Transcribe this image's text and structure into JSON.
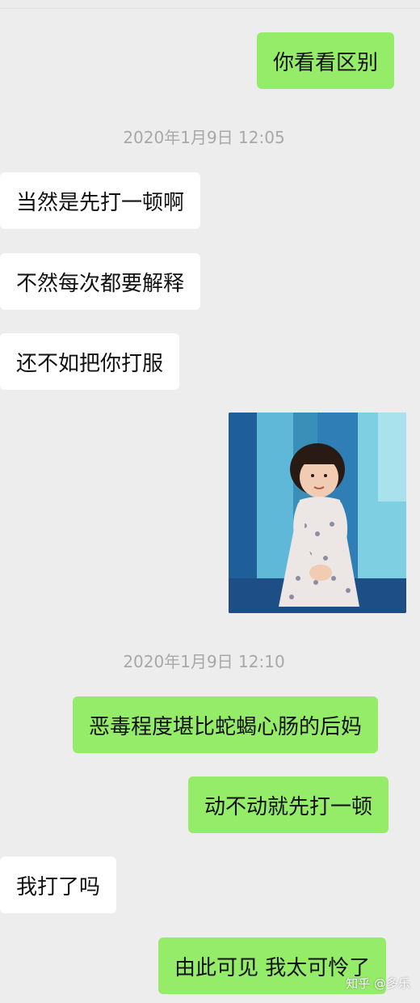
{
  "colors": {
    "background": "#ededed",
    "sent_bubble": "#95ec69",
    "received_bubble": "#ffffff",
    "timestamp_text": "#a8a8a8"
  },
  "messages": [
    {
      "side": "right",
      "text": "你看看区别"
    },
    {
      "type": "timestamp",
      "text": "2020年1月9日 12:05"
    },
    {
      "side": "left",
      "text": "当然是先打一顿啊"
    },
    {
      "side": "left",
      "text": "不然每次都要解释"
    },
    {
      "side": "left",
      "text": "还不如把你打服"
    },
    {
      "side": "right",
      "type": "image",
      "icon": "meme-child-photo"
    },
    {
      "type": "timestamp",
      "text": "2020年1月9日 12:10"
    },
    {
      "side": "right",
      "text": "恶毒程度堪比蛇蝎心肠的后妈"
    },
    {
      "side": "right",
      "text": "动不动就先打一顿"
    },
    {
      "side": "left",
      "text": "我打了吗"
    },
    {
      "side": "right",
      "text": "由此可见 我太可怜了"
    }
  ],
  "watermark": "知乎 @多乐"
}
